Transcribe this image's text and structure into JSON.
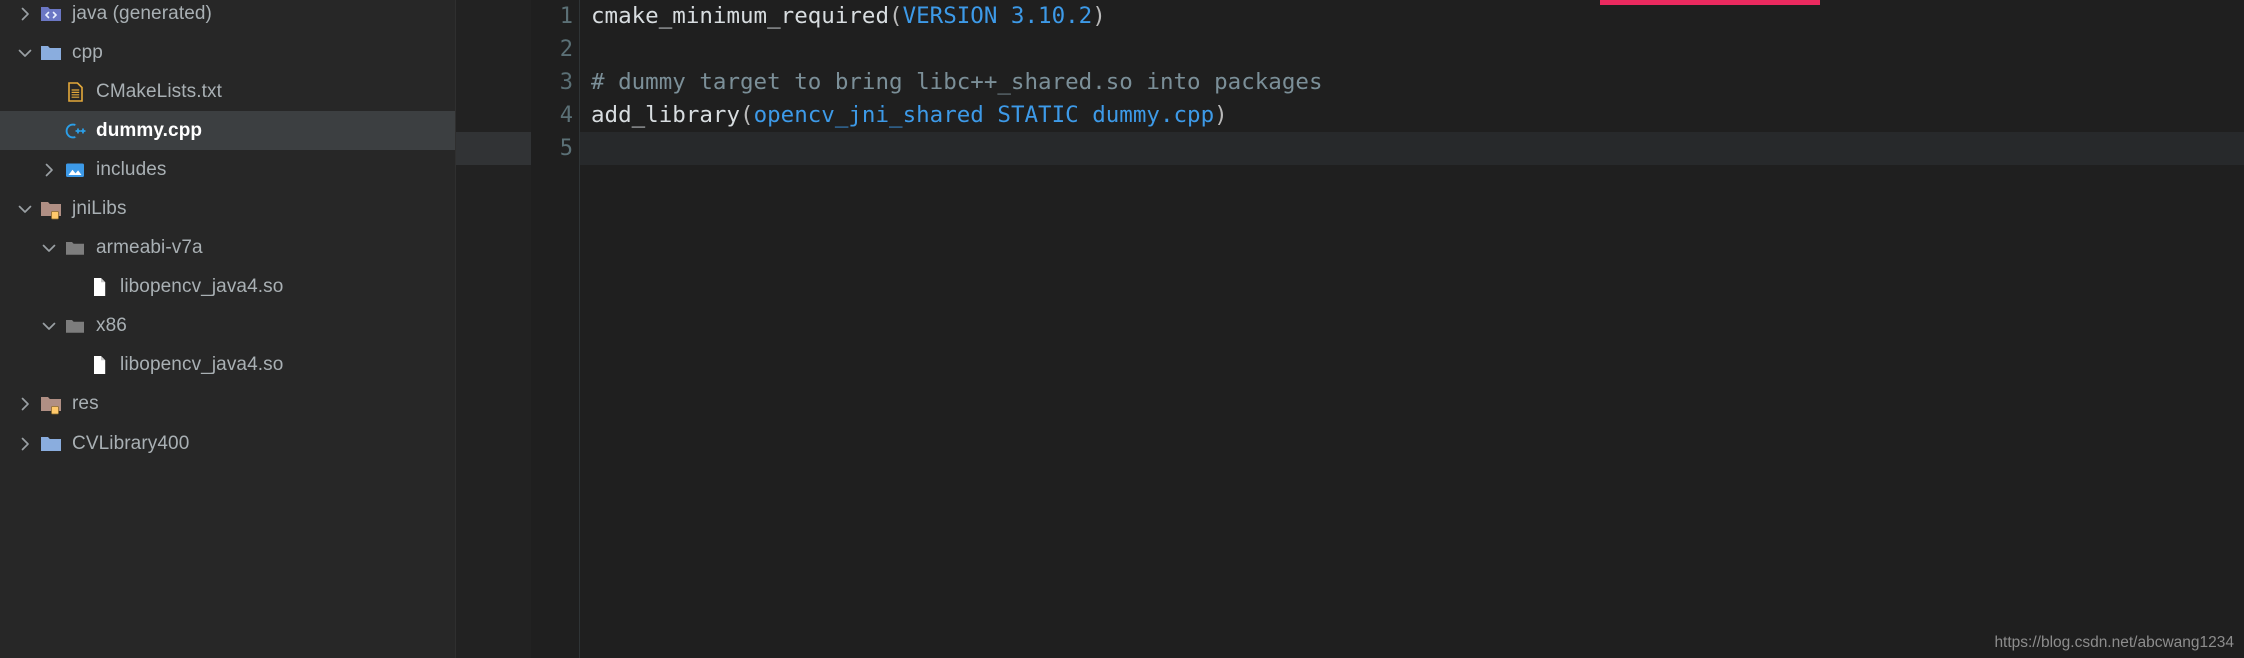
{
  "sidebar": {
    "tree": [
      {
        "label": "java (generated)",
        "icon": "java-generated-folder-icon",
        "twisty": "collapsed",
        "indent": 0,
        "selected": false
      },
      {
        "label": "cpp",
        "icon": "folder-blue-icon",
        "twisty": "expanded",
        "indent": 0,
        "selected": false
      },
      {
        "label": "CMakeLists.txt",
        "icon": "cmake-file-icon",
        "twisty": "none",
        "indent": 1,
        "selected": false
      },
      {
        "label": "dummy.cpp",
        "icon": "cpp-file-icon",
        "twisty": "none",
        "indent": 1,
        "selected": true
      },
      {
        "label": "includes",
        "icon": "includes-folder-icon",
        "twisty": "collapsed",
        "indent": 1,
        "selected": false
      },
      {
        "label": "jniLibs",
        "icon": "folder-resource-icon",
        "twisty": "expanded",
        "indent": 0,
        "selected": false
      },
      {
        "label": "armeabi-v7a",
        "icon": "folder-gray-icon",
        "twisty": "expanded",
        "indent": 1,
        "selected": false
      },
      {
        "label": "libopencv_java4.so",
        "icon": "file-generic-icon",
        "twisty": "none",
        "indent": 2,
        "selected": false
      },
      {
        "label": "x86",
        "icon": "folder-gray-icon",
        "twisty": "expanded",
        "indent": 1,
        "selected": false
      },
      {
        "label": "libopencv_java4.so",
        "icon": "file-generic-icon",
        "twisty": "none",
        "indent": 2,
        "selected": false
      },
      {
        "label": "res",
        "icon": "folder-resource-icon",
        "twisty": "collapsed",
        "indent": 0,
        "selected": false
      },
      {
        "label": "CVLibrary400",
        "icon": "folder-blue-icon",
        "twisty": "collapsed",
        "indent": 0,
        "selected": false
      }
    ]
  },
  "editor": {
    "line_numbers": [
      "1",
      "2",
      "3",
      "4",
      "5"
    ],
    "current_line": 5,
    "lines": [
      {
        "number": "1",
        "tokens": [
          {
            "text": "cmake_minimum_required",
            "kind": "plain"
          },
          {
            "text": "(",
            "kind": "punct"
          },
          {
            "text": "VERSION 3.10.2",
            "kind": "arg"
          },
          {
            "text": ")",
            "kind": "punct"
          }
        ]
      },
      {
        "number": "2",
        "tokens": []
      },
      {
        "number": "3",
        "tokens": [
          {
            "text": "# dummy target to bring libc++_shared.so into packages",
            "kind": "comment"
          }
        ]
      },
      {
        "number": "4",
        "tokens": [
          {
            "text": "add_library",
            "kind": "plain"
          },
          {
            "text": "(",
            "kind": "punct"
          },
          {
            "text": "opencv_jni_shared STATIC dummy.cpp",
            "kind": "arg"
          },
          {
            "text": ")",
            "kind": "punct"
          }
        ]
      },
      {
        "number": "5",
        "tokens": []
      }
    ]
  },
  "overlay": {
    "watermark": "https://blog.csdn.net/abcwang1234",
    "accent_bar_color": "#ea2a5f"
  },
  "colors": {
    "sidebar_bg": "#272727",
    "editor_bg": "#1f1f1f",
    "selection_bg": "#3c3f41",
    "arg_blue": "#3d9ae8",
    "comment_gray": "#7b8f98",
    "accent_pink": "#ea2a5f"
  }
}
